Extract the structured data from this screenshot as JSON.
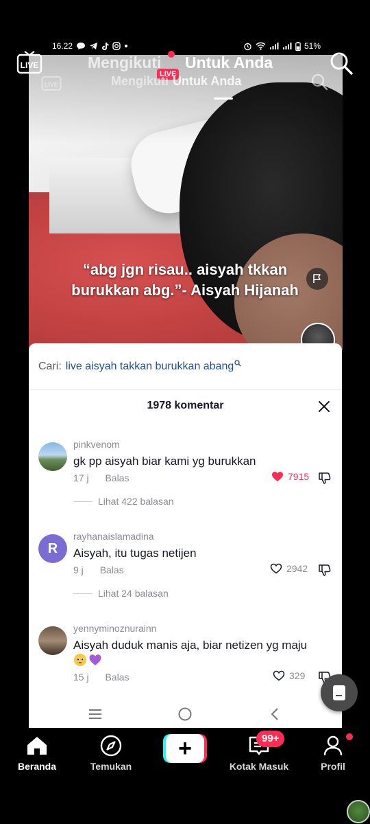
{
  "status_bar": {
    "time": "16.22",
    "battery": "51%"
  },
  "top_nav": {
    "tab_following": "Mengikuti",
    "tab_for_you": "Untuk Anda",
    "live_badge": "LIVE",
    "ghost_following": "Mengikuti",
    "ghost_for_you": "Untuk Anda"
  },
  "video": {
    "caption": "“abg jgn risau.. aisyah tkkan burukkan abg.”- Aisyah Hijanah"
  },
  "comments_sheet": {
    "search_label": "Cari:",
    "search_query": "live aisyah takkan burukkan abang",
    "header": "1978 komentar",
    "reply_label": "Balas",
    "comments": [
      {
        "username": "pinkvenom",
        "text": "gk pp aisyah biar kami yg burukkan",
        "time": "17 j",
        "likes": "7915",
        "liked": true,
        "replies": "Lihat 422 balasan"
      },
      {
        "username": "rayhanaislamadina",
        "avatar_letter": "R",
        "text": "Aisyah, itu tugas netijen",
        "time": "9 j",
        "likes": "2942",
        "liked": false,
        "replies": "Lihat 24 balasan"
      },
      {
        "username": "yennyminoznurainn",
        "text": "Aisyah duduk manis aja, biar netizen yg maju",
        "emojis": [
          "pleading-face-emoji",
          "purple-heart-emoji"
        ],
        "time": "15 j",
        "likes": "329",
        "liked": false
      }
    ]
  },
  "bottom_nav": {
    "home": "Beranda",
    "discover": "Temukan",
    "create": "+",
    "inbox": "Kotak Masuk",
    "inbox_badge": "99+",
    "profile": "Profil"
  },
  "colors": {
    "accent": "#fe2c55",
    "cyan": "#25f4ee",
    "search_link": "#1d4f91",
    "muted_text": "#8a8b91"
  }
}
